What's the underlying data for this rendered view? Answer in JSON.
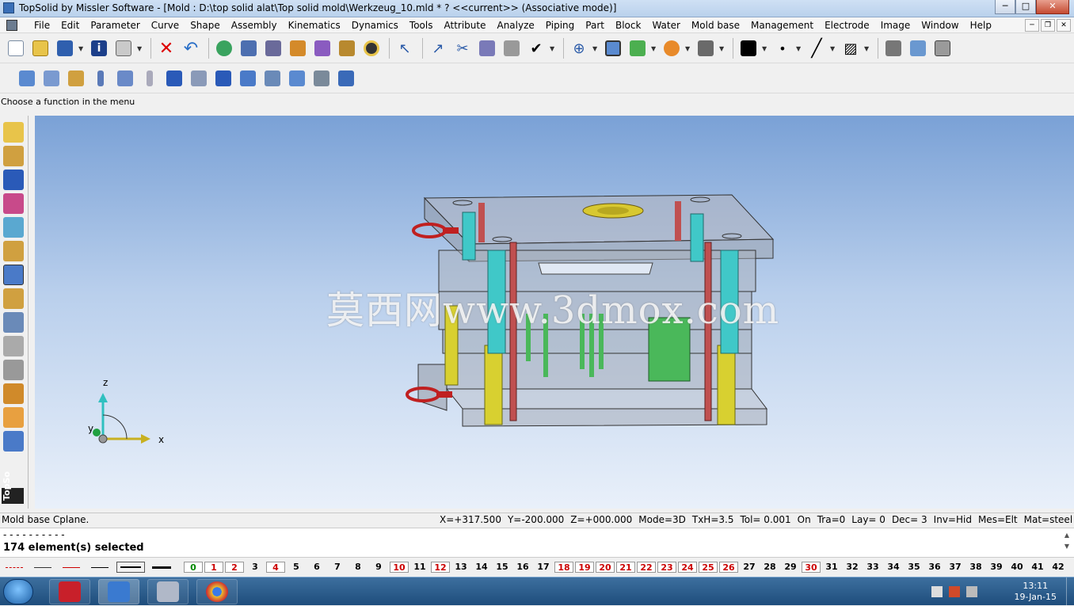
{
  "window": {
    "title": "TopSolid by Missler Software - [Mold : D:\\top solid alat\\Top solid mold\\Werkzeug_10.mld * ?  <<current>> (Associative mode)]",
    "min": "─",
    "max": "□",
    "close": "✕"
  },
  "menu": {
    "items": [
      "File",
      "Edit",
      "Parameter",
      "Curve",
      "Shape",
      "Assembly",
      "Kinematics",
      "Dynamics",
      "Tools",
      "Attribute",
      "Analyze",
      "Piping",
      "Part",
      "Block",
      "Water",
      "Mold base",
      "Management",
      "Electrode",
      "Image",
      "Window",
      "Help"
    ],
    "doc_min": "─",
    "doc_restore": "❐",
    "doc_close": "✕"
  },
  "hint": "Choose a function in the menu",
  "watermark": "莫西网www.3dmox.com",
  "side_brand": "TopSo",
  "triad": {
    "z": "z",
    "y": "y",
    "x": "x"
  },
  "status": {
    "left": "Mold base Cplane.",
    "fields": [
      "X=+317.500",
      "Y=-200.000",
      "Z=+000.000",
      "Mode=3D",
      "TxH=3.5",
      "Tol= 0.001",
      "On",
      "Tra=0",
      "Lay=  0",
      "Dec= 3",
      "Inv=Hid",
      "Mes=Elt",
      "Mat=steel"
    ]
  },
  "command": {
    "dashes": "- - - - - - - - - -",
    "selected": "174 element(s) selected"
  },
  "layers": [
    {
      "n": "0",
      "style": "green"
    },
    {
      "n": "1",
      "style": "red"
    },
    {
      "n": "2",
      "style": "red"
    },
    {
      "n": "3",
      "style": "plain"
    },
    {
      "n": "4",
      "style": "red"
    },
    {
      "n": "5",
      "style": "plain"
    },
    {
      "n": "6",
      "style": "plain"
    },
    {
      "n": "7",
      "style": "plain"
    },
    {
      "n": "8",
      "style": "plain"
    },
    {
      "n": "9",
      "style": "plain"
    },
    {
      "n": "10",
      "style": "red"
    },
    {
      "n": "11",
      "style": "plain"
    },
    {
      "n": "12",
      "style": "red"
    },
    {
      "n": "13",
      "style": "plain"
    },
    {
      "n": "14",
      "style": "plain"
    },
    {
      "n": "15",
      "style": "plain"
    },
    {
      "n": "16",
      "style": "plain"
    },
    {
      "n": "17",
      "style": "plain"
    },
    {
      "n": "18",
      "style": "red"
    },
    {
      "n": "19",
      "style": "red"
    },
    {
      "n": "20",
      "style": "red"
    },
    {
      "n": "21",
      "style": "red"
    },
    {
      "n": "22",
      "style": "red"
    },
    {
      "n": "23",
      "style": "red"
    },
    {
      "n": "24",
      "style": "red"
    },
    {
      "n": "25",
      "style": "red"
    },
    {
      "n": "26",
      "style": "red"
    },
    {
      "n": "27",
      "style": "plain"
    },
    {
      "n": "28",
      "style": "plain"
    },
    {
      "n": "29",
      "style": "plain"
    },
    {
      "n": "30",
      "style": "red"
    },
    {
      "n": "31",
      "style": "plain"
    },
    {
      "n": "32",
      "style": "plain"
    },
    {
      "n": "33",
      "style": "plain"
    },
    {
      "n": "34",
      "style": "plain"
    },
    {
      "n": "35",
      "style": "plain"
    },
    {
      "n": "36",
      "style": "plain"
    },
    {
      "n": "37",
      "style": "plain"
    },
    {
      "n": "38",
      "style": "plain"
    },
    {
      "n": "39",
      "style": "plain"
    },
    {
      "n": "40",
      "style": "plain"
    },
    {
      "n": "41",
      "style": "plain"
    },
    {
      "n": "42",
      "style": "plain"
    }
  ],
  "clock": {
    "time": "13:11",
    "date": "19-Jan-15"
  },
  "colors": {
    "accent_red": "#c00000",
    "layer_green": "#008000",
    "viewport_top": "#7aa1d6",
    "viewport_bottom": "#e9f0fa"
  }
}
